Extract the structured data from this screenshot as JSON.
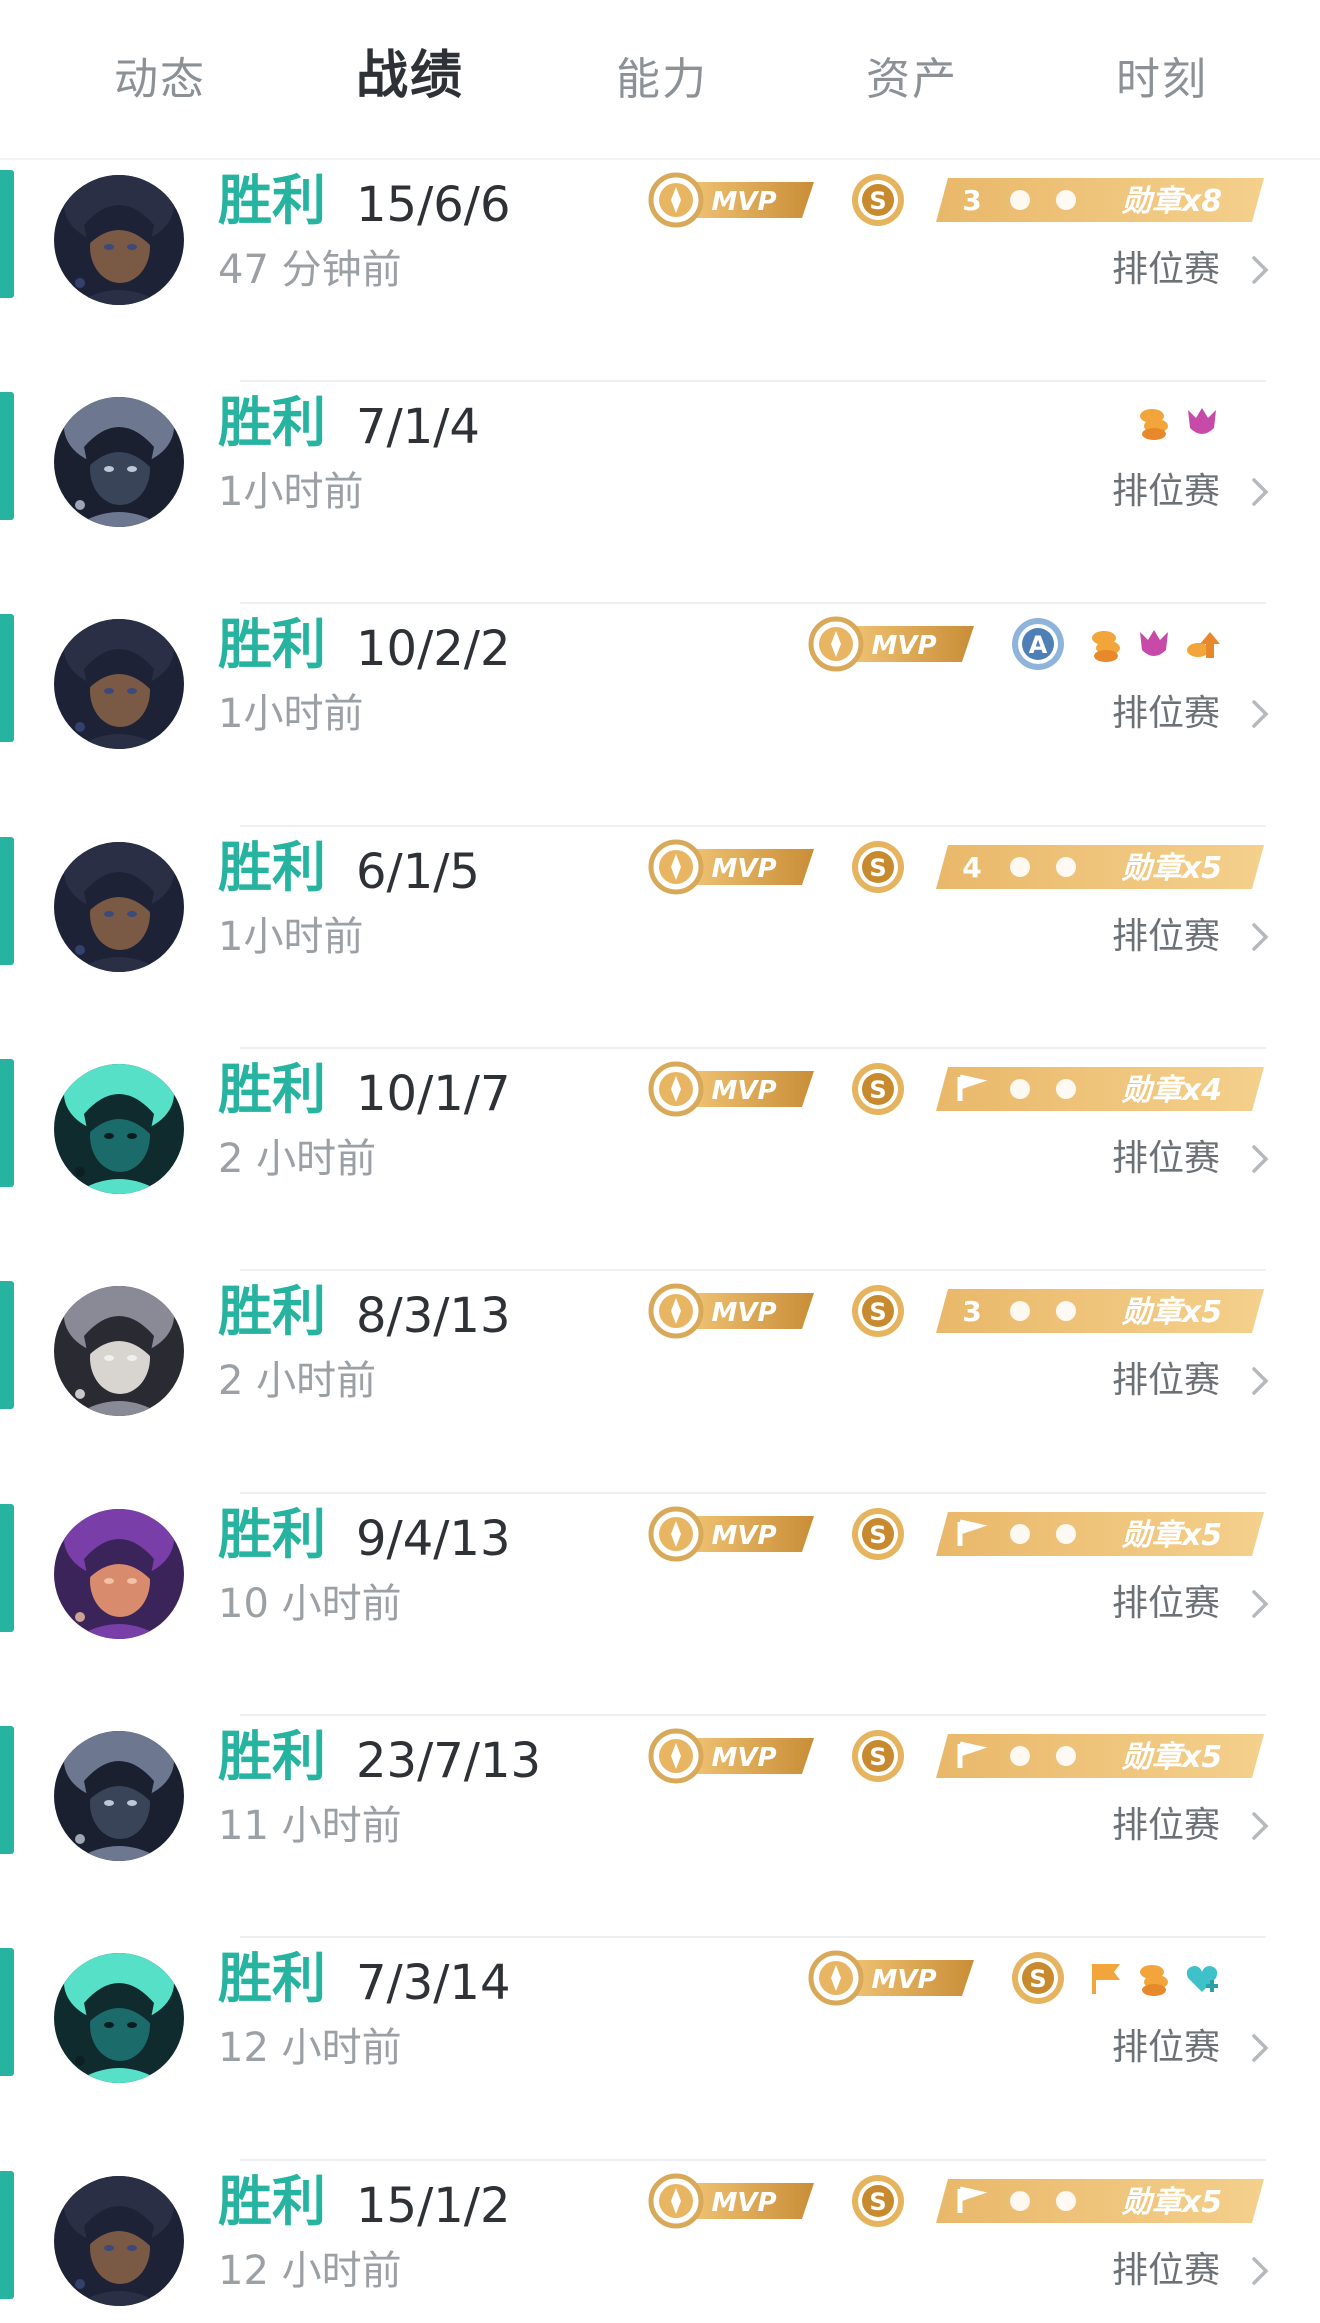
{
  "tabs": [
    "动态",
    "战绩",
    "能力",
    "资产",
    "时刻"
  ],
  "active_tab": 1,
  "mode_label": "排位赛",
  "colors": {
    "accent": "#26b3a0",
    "gold": "#d9a95a",
    "tab_active": "#2e3236"
  },
  "matches": [
    {
      "result": "胜利",
      "kda": "15/6/6",
      "time": "47 分钟前",
      "mvp": true,
      "badge": "s",
      "medal_count": "8",
      "medal_label": "勋章x8",
      "medal_prefix": "3",
      "mini_icons": [],
      "hero": "dark"
    },
    {
      "result": "胜利",
      "kda": "7/1/4",
      "time": "1小时前",
      "mvp": false,
      "badge": "",
      "medal_count": "",
      "medal_label": "",
      "medal_prefix": "",
      "mini_icons": [
        "coins-icon",
        "demon-icon"
      ],
      "hero": "hood"
    },
    {
      "result": "胜利",
      "kda": "10/2/2",
      "time": "1小时前",
      "mvp": true,
      "badge": "a",
      "medal_count": "",
      "medal_label": "",
      "medal_prefix": "",
      "mini_icons": [
        "coins-icon",
        "demon-icon",
        "upgrade-icon"
      ],
      "hero": "dark"
    },
    {
      "result": "胜利",
      "kda": "6/1/5",
      "time": "1小时前",
      "mvp": true,
      "badge": "s",
      "medal_count": "5",
      "medal_label": "勋章x5",
      "medal_prefix": "4",
      "mini_icons": [],
      "hero": "dark"
    },
    {
      "result": "胜利",
      "kda": "10/1/7",
      "time": "2 小时前",
      "mvp": true,
      "badge": "s",
      "medal_count": "4",
      "medal_label": "勋章x4",
      "medal_prefix": "",
      "mini_icons": [],
      "hero": "teal"
    },
    {
      "result": "胜利",
      "kda": "8/3/13",
      "time": "2 小时前",
      "mvp": true,
      "badge": "s",
      "medal_count": "5",
      "medal_label": "勋章x5",
      "medal_prefix": "3",
      "mini_icons": [],
      "hero": "moon"
    },
    {
      "result": "胜利",
      "kda": "9/4/13",
      "time": "10 小时前",
      "mvp": true,
      "badge": "s",
      "medal_count": "5",
      "medal_label": "勋章x5",
      "medal_prefix": "",
      "mini_icons": [],
      "hero": "purple"
    },
    {
      "result": "胜利",
      "kda": "23/7/13",
      "time": "11 小时前",
      "mvp": true,
      "badge": "s",
      "medal_count": "5",
      "medal_label": "勋章x5",
      "medal_prefix": "",
      "mini_icons": [],
      "hero": "hood"
    },
    {
      "result": "胜利",
      "kda": "7/3/14",
      "time": "12 小时前",
      "mvp": true,
      "badge": "s",
      "medal_count": "",
      "medal_label": "",
      "medal_prefix": "",
      "mini_icons": [
        "flag-icon",
        "coins-icon",
        "heart-plus-icon"
      ],
      "hero": "teal"
    },
    {
      "result": "胜利",
      "kda": "15/1/2",
      "time": "12 小时前",
      "mvp": true,
      "badge": "s",
      "medal_count": "5",
      "medal_label": "勋章x5",
      "medal_prefix": "",
      "mini_icons": [],
      "hero": "dark"
    }
  ]
}
